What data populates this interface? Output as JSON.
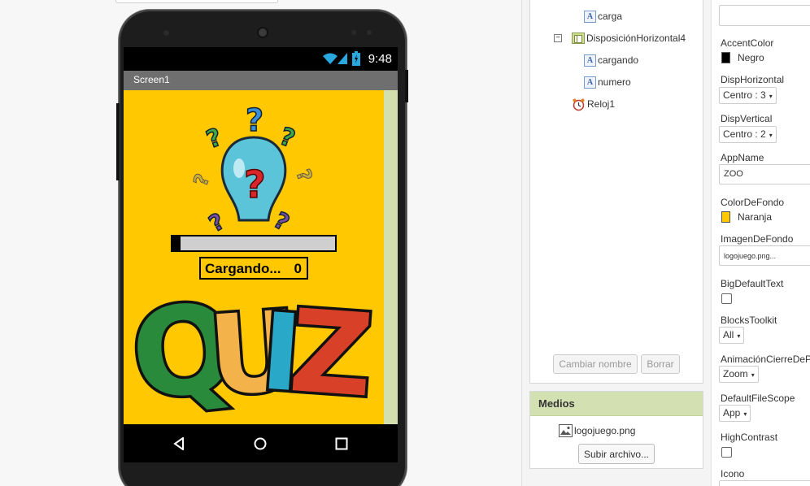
{
  "phone": {
    "status_time": "9:48",
    "screen_title": "Screen1",
    "progress_fraction": 0.05,
    "loading_label": "Cargando...",
    "loading_count": "0",
    "logo_word": "QUIZ"
  },
  "tree": {
    "items": [
      {
        "label": "carga",
        "icon": "label-icon"
      },
      {
        "label": "DisposiciónHorizontal4",
        "icon": "horizontal-arrangement-icon",
        "collapse_glyph": "⊟"
      },
      {
        "label": "cargando",
        "icon": "label-icon"
      },
      {
        "label": "numero",
        "icon": "label-icon"
      },
      {
        "label": "Reloj1",
        "icon": "clock-icon"
      }
    ],
    "rename_button": "Cambiar nombre",
    "delete_button": "Borrar"
  },
  "media": {
    "title": "Medios",
    "file_name": "logojuego.png",
    "upload_button": "Subir archivo..."
  },
  "properties": {
    "accent_color": {
      "label": "AccentColor",
      "value": "Negro",
      "color": "#000000"
    },
    "align_horizontal": {
      "label": "DispHorizontal",
      "value": "Centro : 3"
    },
    "align_vertical": {
      "label": "DispVertical",
      "value": "Centro : 2"
    },
    "app_name": {
      "label": "AppName",
      "value": "ZOO"
    },
    "background_color": {
      "label": "ColorDeFondo",
      "value": "Naranja",
      "color": "#ffc800"
    },
    "background_image": {
      "label": "ImagenDeFondo",
      "value": "logojuego.png..."
    },
    "big_default_text": {
      "label": "BigDefaultText",
      "checked": false
    },
    "blocks_toolkit": {
      "label": "BlocksToolkit",
      "value": "All"
    },
    "close_animation": {
      "label": "AnimaciónCierreDeP",
      "value": "Zoom"
    },
    "default_file_scope": {
      "label": "DefaultFileScope",
      "value": "App"
    },
    "high_contrast": {
      "label": "HighContrast",
      "checked": false
    },
    "icon": {
      "label": "Icono"
    }
  }
}
